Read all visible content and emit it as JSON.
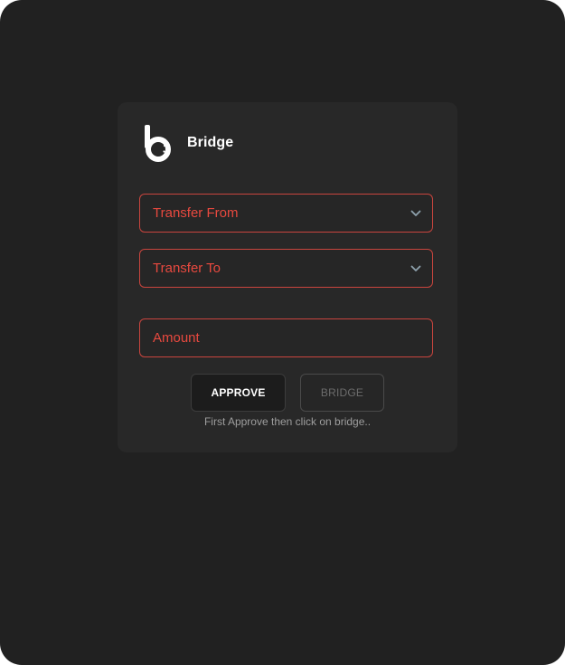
{
  "app": {
    "brand_name": "Bridge",
    "logo_icon": "bridge-b-logo-icon"
  },
  "form": {
    "transfer_from": {
      "label": "Transfer From",
      "icon": "chevron-down-icon"
    },
    "transfer_to": {
      "label": "Transfer To",
      "icon": "chevron-down-icon"
    },
    "amount": {
      "placeholder": "Amount"
    }
  },
  "actions": {
    "approve_label": "APPROVE",
    "bridge_label": "BRIDGE",
    "hint": "First Approve then click on bridge.."
  },
  "colors": {
    "background": "#212121",
    "card": "#282828",
    "accent": "#e8493f",
    "border_accent": "#c9453e",
    "text_primary": "#ffffff",
    "text_muted": "#9e9e9e",
    "disabled": "#6c6c6c"
  }
}
